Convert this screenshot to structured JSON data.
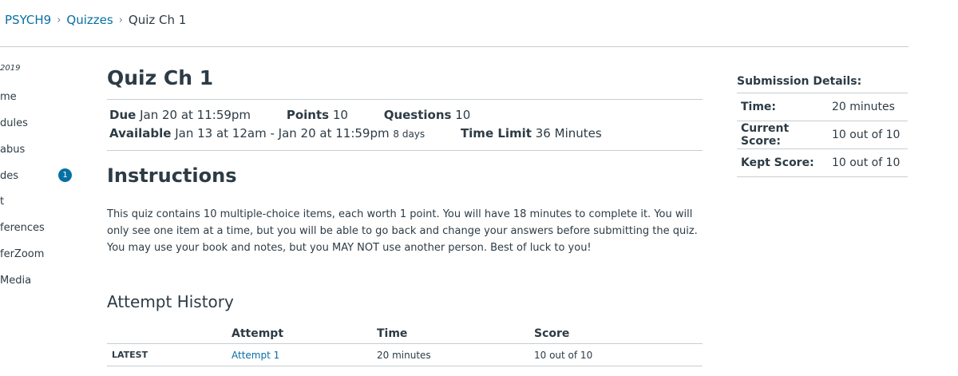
{
  "breadcrumb": {
    "course": "PSYCH9",
    "section": "Quizzes",
    "current": "Quiz Ch 1"
  },
  "nav": {
    "term": "2019",
    "items": [
      "me",
      "dules",
      "abus",
      "des",
      "t",
      "ferences",
      "ferZoom",
      "Media"
    ],
    "grades_badge": "1"
  },
  "quiz": {
    "title": "Quiz Ch 1",
    "due_label": "Due",
    "due_value": "Jan 20 at 11:59pm",
    "points_label": "Points",
    "points_value": "10",
    "questions_label": "Questions",
    "questions_value": "10",
    "available_label": "Available",
    "available_value": "Jan 13 at 12am - Jan 20 at 11:59pm",
    "available_days": "8 days",
    "time_limit_label": "Time Limit",
    "time_limit_value": "36 Minutes"
  },
  "instructions": {
    "heading": "Instructions",
    "body": "This quiz contains 10 multiple-choice items, each worth 1 point. You will have 18 minutes to complete it. You will only see one item at a time, but you will be able to go back and change your answers before submitting the quiz. You may use your book and notes, but you MAY NOT use another person. Best of luck to you!"
  },
  "attempt_history": {
    "heading": "Attempt History",
    "columns": [
      "",
      "Attempt",
      "Time",
      "Score"
    ],
    "rows": [
      {
        "tag": "LATEST",
        "attempt": "Attempt 1",
        "time": "20 minutes",
        "score": "10 out of 10"
      }
    ]
  },
  "submission": {
    "heading": "Submission Details:",
    "rows": [
      {
        "label": "Time:",
        "value": "20 minutes"
      },
      {
        "label": "Current Score:",
        "value": "10 out of 10"
      },
      {
        "label": "Kept Score:",
        "value": "10 out of 10"
      }
    ]
  },
  "colors": {
    "link": "#0770a3",
    "text": "#2d3b45",
    "rule": "#c7cdd1"
  }
}
